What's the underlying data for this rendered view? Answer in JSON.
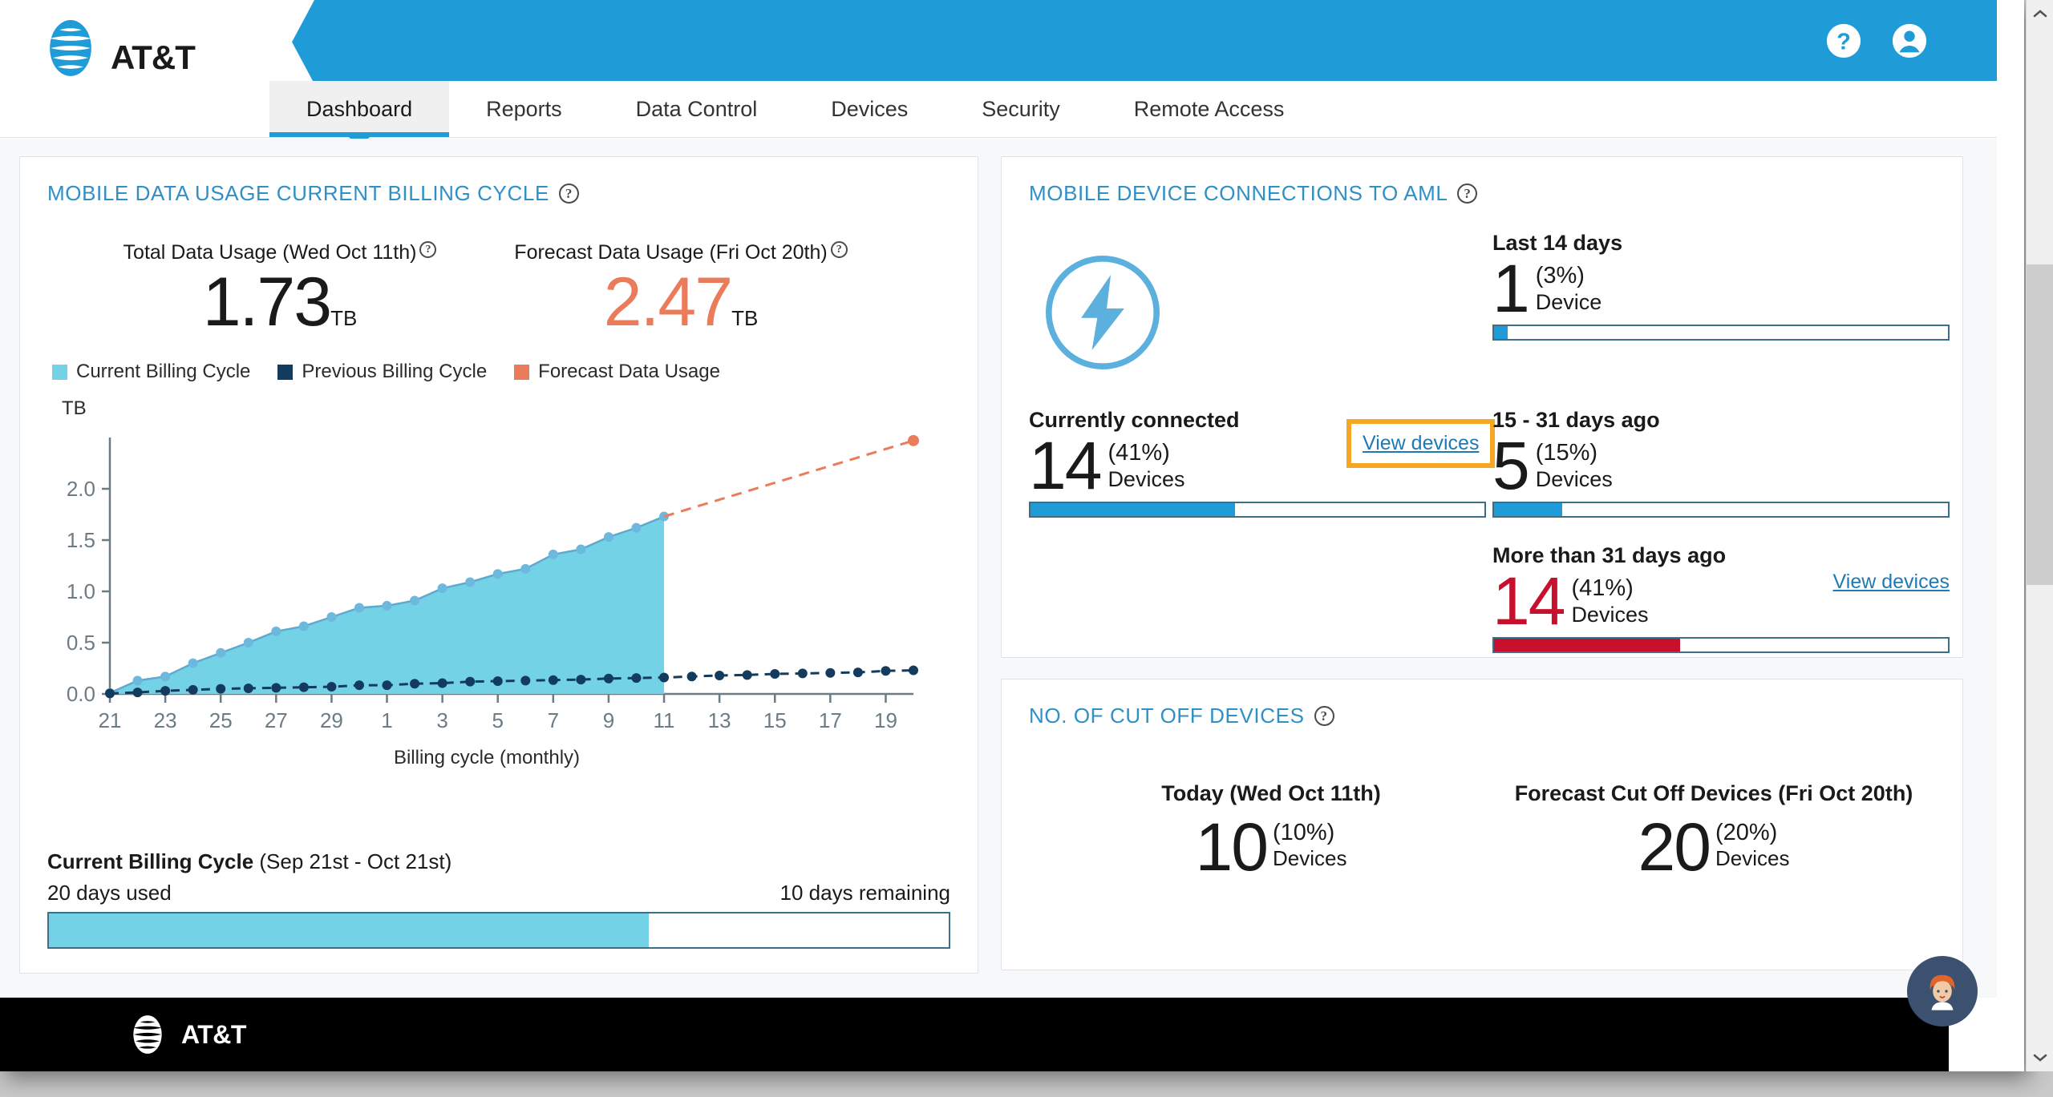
{
  "brand": {
    "name": "AT&T",
    "header_blue": "#1f9bd7",
    "accent_blue": "#2f8fc7",
    "link_blue": "#1e7ab5",
    "cyan": "#74d2e7",
    "navy": "#123b5e",
    "coral": "#ea7c5b",
    "red": "#c8102e",
    "highlight_orange": "#f5a623"
  },
  "header": {
    "help_icon": "help-circle-icon",
    "account_icon": "user-account-icon"
  },
  "nav": {
    "items": [
      {
        "label": "Dashboard",
        "active": true
      },
      {
        "label": "Reports",
        "active": false
      },
      {
        "label": "Data Control",
        "active": false
      },
      {
        "label": "Devices",
        "active": false
      },
      {
        "label": "Security",
        "active": false
      },
      {
        "label": "Remote Access",
        "active": false
      }
    ]
  },
  "usage_card": {
    "title": "MOBILE DATA USAGE CURRENT BILLING CYCLE",
    "help": "?",
    "total": {
      "label": "Total Data Usage (Wed Oct 11th)",
      "value": "1.73",
      "unit": "TB"
    },
    "forecast": {
      "label": "Forecast Data Usage (Fri Oct 20th)",
      "value": "2.47",
      "unit": "TB"
    },
    "legend": [
      {
        "label": "Current Billing Cycle",
        "color": "#74d2e7"
      },
      {
        "label": "Previous Billing Cycle",
        "color": "#123b5e"
      },
      {
        "label": "Forecast Data Usage",
        "color": "#ea7c5b"
      }
    ],
    "billing_cycle": {
      "heading_bold": "Current Billing Cycle",
      "heading_range": "(Sep 21st - Oct 21st)",
      "days_used": "20 days used",
      "days_remaining": "10 days remaining",
      "used_percent": 66.7
    }
  },
  "chart_data": {
    "type": "area",
    "title": "Mobile data usage current billing cycle",
    "xlabel": "Billing cycle (monthly)",
    "ylabel": "TB",
    "yunit": "TB",
    "ylim": [
      0,
      2.5
    ],
    "yticks": [
      0.0,
      0.5,
      1.0,
      1.5,
      2.0
    ],
    "ytick_labels": [
      "0.0",
      "0.5",
      "1.0",
      "1.5",
      "2.0"
    ],
    "xtick_labels": [
      "21",
      "23",
      "25",
      "27",
      "29",
      "1",
      "3",
      "5",
      "7",
      "9",
      "11",
      "13",
      "15",
      "17",
      "19"
    ],
    "x": [
      "21",
      "22",
      "23",
      "24",
      "25",
      "26",
      "27",
      "28",
      "29",
      "30",
      "1",
      "2",
      "3",
      "4",
      "5",
      "6",
      "7",
      "8",
      "9",
      "10",
      "11",
      "12",
      "13",
      "14",
      "15",
      "16",
      "17",
      "18",
      "19",
      "20"
    ],
    "grid": false,
    "legend_position": "above-plot",
    "series": [
      {
        "name": "Current Billing Cycle",
        "color": "#74d2e7",
        "style": "area-solid",
        "values": [
          0.01,
          0.13,
          0.17,
          0.3,
          0.4,
          0.5,
          0.61,
          0.66,
          0.75,
          0.84,
          0.86,
          0.91,
          1.03,
          1.09,
          1.17,
          1.22,
          1.36,
          1.41,
          1.53,
          1.62,
          1.73,
          null,
          null,
          null,
          null,
          null,
          null,
          null,
          null,
          null
        ]
      },
      {
        "name": "Previous Billing Cycle",
        "color": "#123b5e",
        "style": "dashed-line",
        "values": [
          0.005,
          0.015,
          0.03,
          0.04,
          0.05,
          0.055,
          0.06,
          0.065,
          0.07,
          0.085,
          0.085,
          0.1,
          0.105,
          0.12,
          0.125,
          0.13,
          0.135,
          0.14,
          0.15,
          0.155,
          0.16,
          0.17,
          0.18,
          0.185,
          0.195,
          0.2,
          0.205,
          0.21,
          0.225,
          0.23
        ]
      },
      {
        "name": "Forecast Data Usage",
        "color": "#ea7c5b",
        "style": "dashed-line",
        "values": [
          null,
          null,
          null,
          null,
          null,
          null,
          null,
          null,
          null,
          null,
          null,
          null,
          null,
          null,
          null,
          null,
          null,
          null,
          null,
          null,
          1.73,
          null,
          null,
          null,
          null,
          null,
          null,
          null,
          null,
          2.47
        ]
      }
    ]
  },
  "aml_card": {
    "title": "MOBILE DEVICE CONNECTIONS TO AML",
    "help": "?",
    "icon": "lightning-bolt-circle-icon",
    "metrics": [
      {
        "key": "last_14_days",
        "title": "Last 14 days",
        "count": "1",
        "percent": "(3%)",
        "unit": "Device",
        "bar_percent": 3,
        "bar_color": "#1f9bd7",
        "link": null
      },
      {
        "key": "currently_connected",
        "title": "Currently connected",
        "count": "14",
        "percent": "(41%)",
        "unit": "Devices",
        "bar_percent": 45,
        "bar_color": "#1f9bd7",
        "link": "View devices",
        "link_highlighted": true
      },
      {
        "key": "15_31_days_ago",
        "title": "15 - 31 days ago",
        "count": "5",
        "percent": "(15%)",
        "unit": "Devices",
        "bar_percent": 15,
        "bar_color": "#1f9bd7",
        "link": null
      },
      {
        "key": "more_than_31_days_ago",
        "title": "More than 31 days ago",
        "count": "14",
        "percent": "(41%)",
        "unit": "Devices",
        "bar_percent": 41,
        "bar_color": "#c8102e",
        "link": "View devices",
        "link_highlighted": false
      }
    ]
  },
  "cutoff_card": {
    "title": "NO. OF CUT OFF DEVICES",
    "help": "?",
    "today": {
      "label": "Today (Wed Oct 11th)",
      "count": "10",
      "percent": "(10%)",
      "unit": "Devices"
    },
    "forecast": {
      "label": "Forecast Cut Off Devices (Fri Oct 20th)",
      "count": "20",
      "percent": "(20%)",
      "unit": "Devices"
    }
  },
  "footer": {
    "brand": "AT&T"
  },
  "chat": {
    "icon": "agent-avatar-icon"
  },
  "scrollbar": {
    "up": "chevron-up-icon",
    "down": "chevron-down-icon"
  }
}
